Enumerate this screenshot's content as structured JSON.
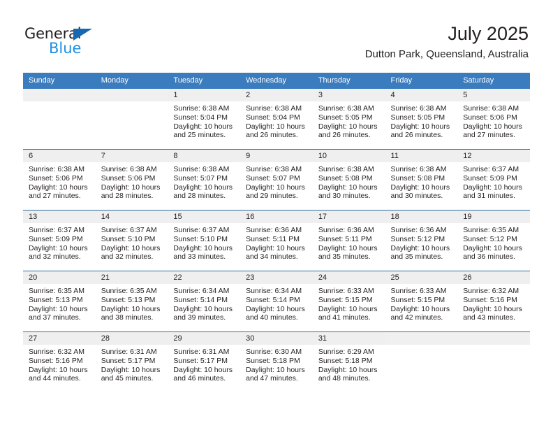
{
  "logo": {
    "word_top": "General",
    "word_bottom": "Blue",
    "triangle_color": "#1668b3",
    "blue_color": "#1f8fe0"
  },
  "header": {
    "title": "July 2025",
    "subtitle": "Dutton Park, Queensland, Australia"
  },
  "theme": {
    "header_blue": "#3a7cbe",
    "row_rule_blue": "#2e6da4",
    "daynum_band": "#efefef"
  },
  "weekdays": [
    "Sunday",
    "Monday",
    "Tuesday",
    "Wednesday",
    "Thursday",
    "Friday",
    "Saturday"
  ],
  "weeks": [
    [
      {
        "day": "",
        "lines": []
      },
      {
        "day": "",
        "lines": []
      },
      {
        "day": "1",
        "lines": [
          "Sunrise: 6:38 AM",
          "Sunset: 5:04 PM",
          "Daylight: 10 hours",
          "and 25 minutes."
        ]
      },
      {
        "day": "2",
        "lines": [
          "Sunrise: 6:38 AM",
          "Sunset: 5:04 PM",
          "Daylight: 10 hours",
          "and 26 minutes."
        ]
      },
      {
        "day": "3",
        "lines": [
          "Sunrise: 6:38 AM",
          "Sunset: 5:05 PM",
          "Daylight: 10 hours",
          "and 26 minutes."
        ]
      },
      {
        "day": "4",
        "lines": [
          "Sunrise: 6:38 AM",
          "Sunset: 5:05 PM",
          "Daylight: 10 hours",
          "and 26 minutes."
        ]
      },
      {
        "day": "5",
        "lines": [
          "Sunrise: 6:38 AM",
          "Sunset: 5:06 PM",
          "Daylight: 10 hours",
          "and 27 minutes."
        ]
      }
    ],
    [
      {
        "day": "6",
        "lines": [
          "Sunrise: 6:38 AM",
          "Sunset: 5:06 PM",
          "Daylight: 10 hours",
          "and 27 minutes."
        ]
      },
      {
        "day": "7",
        "lines": [
          "Sunrise: 6:38 AM",
          "Sunset: 5:06 PM",
          "Daylight: 10 hours",
          "and 28 minutes."
        ]
      },
      {
        "day": "8",
        "lines": [
          "Sunrise: 6:38 AM",
          "Sunset: 5:07 PM",
          "Daylight: 10 hours",
          "and 28 minutes."
        ]
      },
      {
        "day": "9",
        "lines": [
          "Sunrise: 6:38 AM",
          "Sunset: 5:07 PM",
          "Daylight: 10 hours",
          "and 29 minutes."
        ]
      },
      {
        "day": "10",
        "lines": [
          "Sunrise: 6:38 AM",
          "Sunset: 5:08 PM",
          "Daylight: 10 hours",
          "and 30 minutes."
        ]
      },
      {
        "day": "11",
        "lines": [
          "Sunrise: 6:38 AM",
          "Sunset: 5:08 PM",
          "Daylight: 10 hours",
          "and 30 minutes."
        ]
      },
      {
        "day": "12",
        "lines": [
          "Sunrise: 6:37 AM",
          "Sunset: 5:09 PM",
          "Daylight: 10 hours",
          "and 31 minutes."
        ]
      }
    ],
    [
      {
        "day": "13",
        "lines": [
          "Sunrise: 6:37 AM",
          "Sunset: 5:09 PM",
          "Daylight: 10 hours",
          "and 32 minutes."
        ]
      },
      {
        "day": "14",
        "lines": [
          "Sunrise: 6:37 AM",
          "Sunset: 5:10 PM",
          "Daylight: 10 hours",
          "and 32 minutes."
        ]
      },
      {
        "day": "15",
        "lines": [
          "Sunrise: 6:37 AM",
          "Sunset: 5:10 PM",
          "Daylight: 10 hours",
          "and 33 minutes."
        ]
      },
      {
        "day": "16",
        "lines": [
          "Sunrise: 6:36 AM",
          "Sunset: 5:11 PM",
          "Daylight: 10 hours",
          "and 34 minutes."
        ]
      },
      {
        "day": "17",
        "lines": [
          "Sunrise: 6:36 AM",
          "Sunset: 5:11 PM",
          "Daylight: 10 hours",
          "and 35 minutes."
        ]
      },
      {
        "day": "18",
        "lines": [
          "Sunrise: 6:36 AM",
          "Sunset: 5:12 PM",
          "Daylight: 10 hours",
          "and 35 minutes."
        ]
      },
      {
        "day": "19",
        "lines": [
          "Sunrise: 6:35 AM",
          "Sunset: 5:12 PM",
          "Daylight: 10 hours",
          "and 36 minutes."
        ]
      }
    ],
    [
      {
        "day": "20",
        "lines": [
          "Sunrise: 6:35 AM",
          "Sunset: 5:13 PM",
          "Daylight: 10 hours",
          "and 37 minutes."
        ]
      },
      {
        "day": "21",
        "lines": [
          "Sunrise: 6:35 AM",
          "Sunset: 5:13 PM",
          "Daylight: 10 hours",
          "and 38 minutes."
        ]
      },
      {
        "day": "22",
        "lines": [
          "Sunrise: 6:34 AM",
          "Sunset: 5:14 PM",
          "Daylight: 10 hours",
          "and 39 minutes."
        ]
      },
      {
        "day": "23",
        "lines": [
          "Sunrise: 6:34 AM",
          "Sunset: 5:14 PM",
          "Daylight: 10 hours",
          "and 40 minutes."
        ]
      },
      {
        "day": "24",
        "lines": [
          "Sunrise: 6:33 AM",
          "Sunset: 5:15 PM",
          "Daylight: 10 hours",
          "and 41 minutes."
        ]
      },
      {
        "day": "25",
        "lines": [
          "Sunrise: 6:33 AM",
          "Sunset: 5:15 PM",
          "Daylight: 10 hours",
          "and 42 minutes."
        ]
      },
      {
        "day": "26",
        "lines": [
          "Sunrise: 6:32 AM",
          "Sunset: 5:16 PM",
          "Daylight: 10 hours",
          "and 43 minutes."
        ]
      }
    ],
    [
      {
        "day": "27",
        "lines": [
          "Sunrise: 6:32 AM",
          "Sunset: 5:16 PM",
          "Daylight: 10 hours",
          "and 44 minutes."
        ]
      },
      {
        "day": "28",
        "lines": [
          "Sunrise: 6:31 AM",
          "Sunset: 5:17 PM",
          "Daylight: 10 hours",
          "and 45 minutes."
        ]
      },
      {
        "day": "29",
        "lines": [
          "Sunrise: 6:31 AM",
          "Sunset: 5:17 PM",
          "Daylight: 10 hours",
          "and 46 minutes."
        ]
      },
      {
        "day": "30",
        "lines": [
          "Sunrise: 6:30 AM",
          "Sunset: 5:18 PM",
          "Daylight: 10 hours",
          "and 47 minutes."
        ]
      },
      {
        "day": "31",
        "lines": [
          "Sunrise: 6:29 AM",
          "Sunset: 5:18 PM",
          "Daylight: 10 hours",
          "and 48 minutes."
        ]
      },
      {
        "day": "",
        "lines": []
      },
      {
        "day": "",
        "lines": []
      }
    ]
  ]
}
